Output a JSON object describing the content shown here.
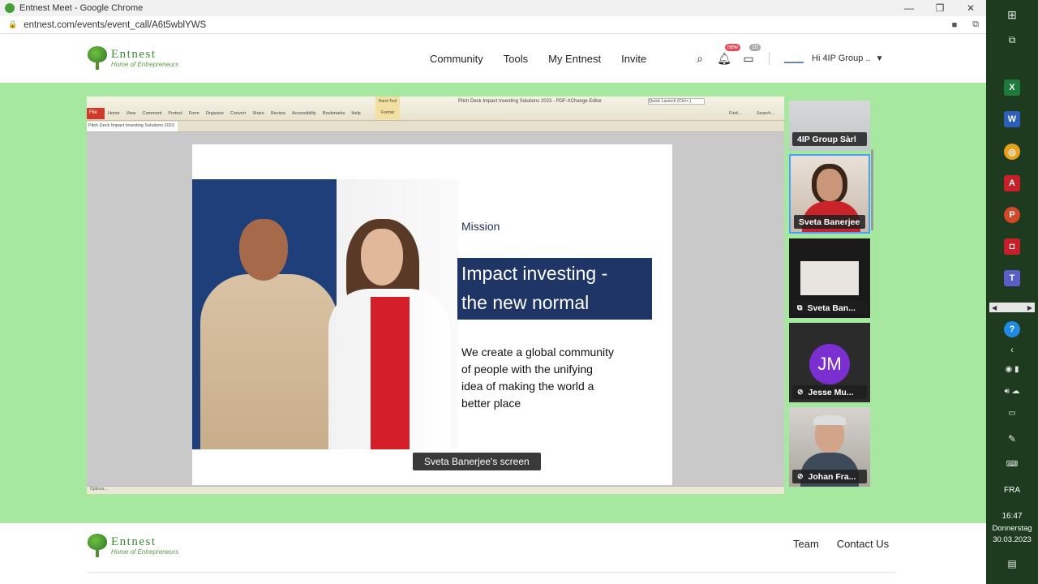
{
  "browser": {
    "window_title": "Entnest Meet - Google Chrome",
    "url": "entnest.com/events/event_call/A6t5wblYWS"
  },
  "header": {
    "logo_brand": "Entnest",
    "logo_tagline": "Home of Entrepreneurs",
    "nav": [
      "Community",
      "Tools",
      "My Entnest",
      "Invite"
    ],
    "notif_badge": "new",
    "messages_badge": "10",
    "user_label": "Hi 4IP Group ..",
    "icons": [
      "search-icon",
      "bell-icon",
      "chat-icon",
      "chevron-down-icon"
    ]
  },
  "shared_app": {
    "doc_title": "Pitch Deck Impact Investing Solutions 2023 - PDF-XChange Editor",
    "doc_tab": "Pitch Deck Impact Investing Solutions 2023",
    "file_menu": "File",
    "ribbon": [
      "Home",
      "View",
      "Comment",
      "Protect",
      "Form",
      "Organize",
      "Convert",
      "Share",
      "Review",
      "Accessibility",
      "Bookmarks",
      "Help"
    ],
    "hand_tool": "Hand Tool",
    "format": "Format",
    "search_placeholder": "Quick Launch (Ctrl+.)",
    "find": "Find...",
    "search": "Search...",
    "status": "Options..."
  },
  "slide": {
    "mission": "Mission",
    "headline_line1": "Impact investing -",
    "headline_line2": "the new normal",
    "desc_line1": "We create a global community",
    "desc_line2": "of people with the unifying",
    "desc_line3": "idea of making the world a",
    "desc_line4": "better place"
  },
  "screen_label": "Sveta Banerjee's screen",
  "participants": [
    {
      "name": "4IP Group Sàrl"
    },
    {
      "name": "Sveta Banerjee"
    },
    {
      "name": "Sveta Ban..."
    },
    {
      "name": "Jesse Mu...",
      "initials": "JM"
    },
    {
      "name": "Johan Fra..."
    }
  ],
  "footer": {
    "logo_brand": "Entnest",
    "logo_tagline": "Home of Entrepreneurs",
    "links": [
      "Team",
      "Contact Us"
    ]
  },
  "taskbar": {
    "apps": [
      {
        "letter": "X",
        "color": "#1d7a3c"
      },
      {
        "letter": "W",
        "color": "#2b5fb8"
      },
      {
        "letter": "◎",
        "color": "#e8a020"
      },
      {
        "letter": "A",
        "color": "#c8202a"
      },
      {
        "letter": "P",
        "color": "#d24726"
      },
      {
        "letter": "◘",
        "color": "#c8202a"
      },
      {
        "letter": "T",
        "color": "#5a5fc7"
      }
    ],
    "lang": "FRA",
    "time": "16:47",
    "day": "Donnerstag",
    "date": "30.03.2023"
  },
  "colors": {
    "meeting_bg": "#a6e8a0",
    "brand_green": "#3a8a35",
    "slide_blue": "#1e3566"
  }
}
